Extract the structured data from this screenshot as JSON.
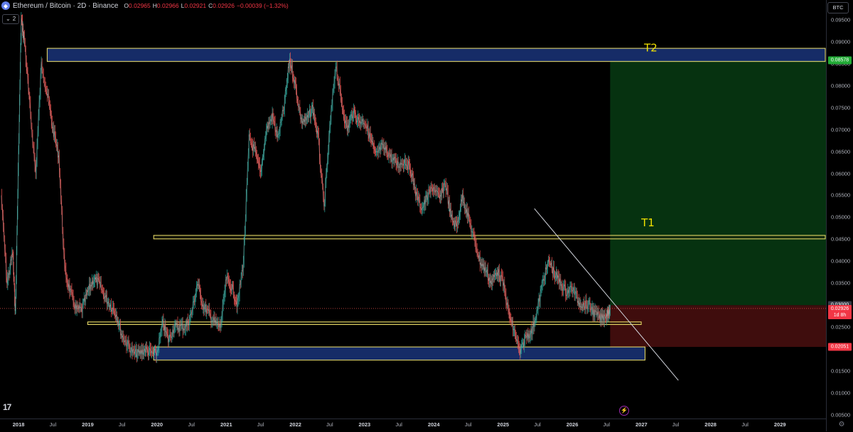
{
  "header": {
    "symbol_title": "Ethereum / Bitcoin · 2D · Binance",
    "symbol_icon": "ethereum-icon",
    "ohlc": [
      {
        "label": "O",
        "value": "0.02965"
      },
      {
        "label": "H",
        "value": "0.02966"
      },
      {
        "label": "L",
        "value": "0.02921"
      },
      {
        "label": "C",
        "value": "0.02926"
      },
      {
        "label": "",
        "value": "−0.00039 (−1.32%)"
      }
    ],
    "collapse_label": "2",
    "collapse_icon": "chevron-down-icon"
  },
  "colors": {
    "background": "#000000",
    "up": "#26a69a",
    "down": "#ef5350",
    "zone_fill": "#1e3b8a",
    "zone_stroke": "#f2e36b",
    "profit_zone": "#063210",
    "loss_zone": "#3f0d0d",
    "trendline": "#d1d4dc",
    "annotation": "#f2e200"
  },
  "price_scale": {
    "currency": "BTC",
    "ticks": [
      "0.09500",
      "0.09000",
      "0.08500",
      "0.08000",
      "0.07500",
      "0.07000",
      "0.06500",
      "0.06000",
      "0.05500",
      "0.05000",
      "0.04500",
      "0.04000",
      "0.03500",
      "0.03000",
      "0.02500",
      "0.02000",
      "0.01500",
      "0.01000",
      "0.00500"
    ],
    "badges": [
      {
        "value": "0.08578",
        "color": "#22ab36"
      },
      {
        "value": "0.03000",
        "color": "#363a45"
      },
      {
        "value": "0.02926",
        "sub": "1d 8h",
        "color": "#f23645"
      },
      {
        "value": "0.02051",
        "color": "#f23645"
      }
    ],
    "settings_icon": "gear-icon"
  },
  "time_scale": {
    "ticks": [
      {
        "label": "2018",
        "year": true
      },
      {
        "label": "Jul",
        "year": false
      },
      {
        "label": "2019",
        "year": true
      },
      {
        "label": "Jul",
        "year": false
      },
      {
        "label": "2020",
        "year": true
      },
      {
        "label": "Jul",
        "year": false
      },
      {
        "label": "2021",
        "year": true
      },
      {
        "label": "Jul",
        "year": false
      },
      {
        "label": "2022",
        "year": true
      },
      {
        "label": "Jul",
        "year": false
      },
      {
        "label": "2023",
        "year": true
      },
      {
        "label": "Jul",
        "year": false
      },
      {
        "label": "2024",
        "year": true
      },
      {
        "label": "Jul",
        "year": false
      },
      {
        "label": "2025",
        "year": true
      },
      {
        "label": "Jul",
        "year": false
      },
      {
        "label": "2026",
        "year": true
      },
      {
        "label": "Jul",
        "year": false
      },
      {
        "label": "2027",
        "year": true
      },
      {
        "label": "Jul",
        "year": false
      },
      {
        "label": "2028",
        "year": true
      },
      {
        "label": "Jul",
        "year": false
      },
      {
        "label": "2029",
        "year": true
      }
    ]
  },
  "branding": {
    "logo_text": "17",
    "logo_icon": "tradingview-logo-icon",
    "replay_icon": "lightning-icon"
  },
  "chart_data": {
    "type": "line",
    "ylim": [
      0.0042,
      0.0995
    ],
    "xlim": [
      "2017-09-25",
      "2029-09-01"
    ],
    "series": [
      {
        "values": [
          [
            "2017-10-01",
            0.055
          ],
          [
            "2017-11-01",
            0.035
          ],
          [
            "2017-12-01",
            0.042
          ],
          [
            "2017-12-15",
            0.028
          ],
          [
            "2018-01-01",
            0.065
          ],
          [
            "2018-01-15",
            0.095
          ],
          [
            "2018-02-01",
            0.09
          ],
          [
            "2018-03-01",
            0.075
          ],
          [
            "2018-04-01",
            0.06
          ],
          [
            "2018-05-01",
            0.085
          ],
          [
            "2018-06-01",
            0.078
          ],
          [
            "2018-07-01",
            0.07
          ],
          [
            "2018-08-01",
            0.064
          ],
          [
            "2018-09-01",
            0.038
          ],
          [
            "2018-10-01",
            0.033
          ],
          [
            "2018-11-01",
            0.029
          ],
          [
            "2018-12-01",
            0.029
          ],
          [
            "2019-01-01",
            0.033
          ],
          [
            "2019-02-01",
            0.036
          ],
          [
            "2019-03-01",
            0.035
          ],
          [
            "2019-04-01",
            0.032
          ],
          [
            "2019-05-01",
            0.03
          ],
          [
            "2019-06-01",
            0.028
          ],
          [
            "2019-07-01",
            0.023
          ],
          [
            "2019-08-01",
            0.021
          ],
          [
            "2019-09-01",
            0.019
          ],
          [
            "2019-10-01",
            0.019
          ],
          [
            "2019-11-01",
            0.02
          ],
          [
            "2019-12-01",
            0.019
          ],
          [
            "2020-01-01",
            0.019
          ],
          [
            "2020-02-01",
            0.026
          ],
          [
            "2020-03-01",
            0.022
          ],
          [
            "2020-04-01",
            0.025
          ],
          [
            "2020-05-01",
            0.025
          ],
          [
            "2020-06-01",
            0.025
          ],
          [
            "2020-07-01",
            0.028
          ],
          [
            "2020-08-01",
            0.035
          ],
          [
            "2020-09-01",
            0.03
          ],
          [
            "2020-10-01",
            0.028
          ],
          [
            "2020-11-01",
            0.026
          ],
          [
            "2020-12-01",
            0.025
          ],
          [
            "2021-01-01",
            0.036
          ],
          [
            "2021-02-01",
            0.034
          ],
          [
            "2021-03-01",
            0.03
          ],
          [
            "2021-04-01",
            0.04
          ],
          [
            "2021-05-01",
            0.068
          ],
          [
            "2021-06-01",
            0.065
          ],
          [
            "2021-07-01",
            0.06
          ],
          [
            "2021-08-01",
            0.07
          ],
          [
            "2021-09-01",
            0.073
          ],
          [
            "2021-10-01",
            0.068
          ],
          [
            "2021-11-01",
            0.075
          ],
          [
            "2021-12-01",
            0.086
          ],
          [
            "2022-01-01",
            0.08
          ],
          [
            "2022-02-01",
            0.072
          ],
          [
            "2022-03-01",
            0.072
          ],
          [
            "2022-04-01",
            0.075
          ],
          [
            "2022-05-01",
            0.068
          ],
          [
            "2022-06-01",
            0.052
          ],
          [
            "2022-07-01",
            0.07
          ],
          [
            "2022-08-01",
            0.085
          ],
          [
            "2022-09-01",
            0.076
          ],
          [
            "2022-10-01",
            0.07
          ],
          [
            "2022-11-01",
            0.074
          ],
          [
            "2022-12-01",
            0.072
          ],
          [
            "2023-01-01",
            0.072
          ],
          [
            "2023-02-01",
            0.068
          ],
          [
            "2023-03-01",
            0.064
          ],
          [
            "2023-04-01",
            0.066
          ],
          [
            "2023-05-01",
            0.065
          ],
          [
            "2023-06-01",
            0.063
          ],
          [
            "2023-07-01",
            0.062
          ],
          [
            "2023-08-01",
            0.063
          ],
          [
            "2023-09-01",
            0.061
          ],
          [
            "2023-10-01",
            0.055
          ],
          [
            "2023-11-01",
            0.052
          ],
          [
            "2023-12-01",
            0.055
          ],
          [
            "2024-01-01",
            0.057
          ],
          [
            "2024-02-01",
            0.054
          ],
          [
            "2024-03-01",
            0.058
          ],
          [
            "2024-04-01",
            0.05
          ],
          [
            "2024-05-01",
            0.048
          ],
          [
            "2024-06-01",
            0.055
          ],
          [
            "2024-07-01",
            0.05
          ],
          [
            "2024-08-01",
            0.045
          ],
          [
            "2024-09-01",
            0.04
          ],
          [
            "2024-10-01",
            0.038
          ],
          [
            "2024-11-01",
            0.035
          ],
          [
            "2024-12-01",
            0.038
          ],
          [
            "2025-01-01",
            0.035
          ],
          [
            "2025-02-01",
            0.028
          ],
          [
            "2025-03-01",
            0.024
          ],
          [
            "2025-04-01",
            0.019
          ],
          [
            "2025-05-01",
            0.023
          ],
          [
            "2025-06-01",
            0.024
          ],
          [
            "2025-07-01",
            0.029
          ],
          [
            "2025-08-01",
            0.036
          ],
          [
            "2025-09-01",
            0.04
          ],
          [
            "2025-10-01",
            0.037
          ],
          [
            "2025-11-01",
            0.035
          ],
          [
            "2025-12-01",
            0.033
          ],
          [
            "2026-01-01",
            0.034
          ],
          [
            "2026-02-01",
            0.031
          ],
          [
            "2026-03-01",
            0.03
          ],
          [
            "2026-04-01",
            0.03
          ],
          [
            "2026-05-01",
            0.028
          ],
          [
            "2026-06-01",
            0.027
          ],
          [
            "2026-07-01",
            0.028
          ],
          [
            "2026-07-20",
            0.02926
          ]
        ]
      }
    ],
    "zones": [
      {
        "from": "2018-06-01",
        "to": "2029-09-01",
        "low": 0.0855,
        "high": 0.0885,
        "kind": "blue"
      },
      {
        "from": "2019-12-15",
        "to": "2029-09-01",
        "low": 0.0451,
        "high": 0.0459,
        "kind": "yellow-line"
      },
      {
        "from": "2019-01-01",
        "to": "2026-12-31",
        "low": 0.0256,
        "high": 0.0262,
        "kind": "yellow-line"
      },
      {
        "from": "2019-12-15",
        "to": "2027-01-20",
        "low": 0.0175,
        "high": 0.0205,
        "kind": "blue"
      }
    ],
    "position": {
      "from": "2026-07-20",
      "to": "2029-09-01",
      "entry": 0.03,
      "target": 0.08578,
      "stop": 0.02051
    },
    "trendline": {
      "from": [
        "2025-06-15",
        0.052
      ],
      "to": [
        "2027-07-15",
        0.0129
      ]
    },
    "last_price": 0.02926,
    "annotations": [
      {
        "text": "T2",
        "x": "2027-01-15",
        "y": 0.0878
      },
      {
        "text": "T1",
        "x": "2026-12-31",
        "y": 0.048
      }
    ]
  }
}
